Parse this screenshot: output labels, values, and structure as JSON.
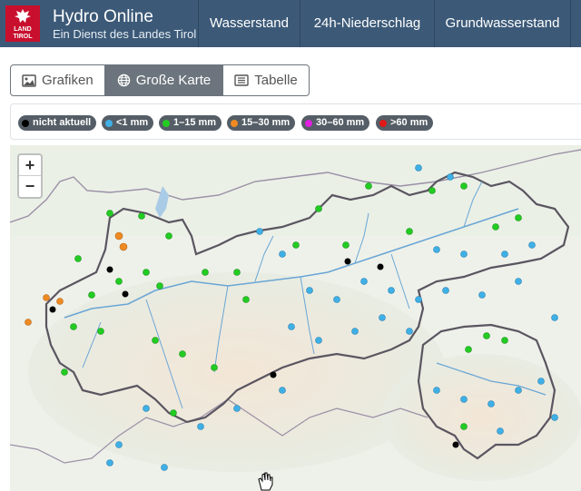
{
  "header": {
    "logo_text": "LAND TIROL",
    "title": "Hydro Online",
    "subtitle": "Ein Dienst des Landes Tirol",
    "nav": [
      "Wasserstand",
      "24h-Niederschlag",
      "Grundwasserstand"
    ]
  },
  "view_tabs": [
    {
      "label": "Grafiken",
      "icon": "image-icon",
      "active": false
    },
    {
      "label": "Große Karte",
      "icon": "globe-icon",
      "active": true
    },
    {
      "label": "Tabelle",
      "icon": "table-icon",
      "active": false
    }
  ],
  "legend": [
    {
      "label": "nicht aktuell",
      "color": "#000000"
    },
    {
      "label": "<1 mm",
      "color": "#3fb0e6"
    },
    {
      "label": "1–15 mm",
      "color": "#22cc22"
    },
    {
      "label": "15–30 mm",
      "color": "#ee8a22"
    },
    {
      "label": "30–60 mm",
      "color": "#e020e0"
    },
    {
      "label": ">60 mm",
      "color": "#e01818"
    }
  ],
  "map": {
    "zoom_in": "+",
    "zoom_out": "−"
  }
}
